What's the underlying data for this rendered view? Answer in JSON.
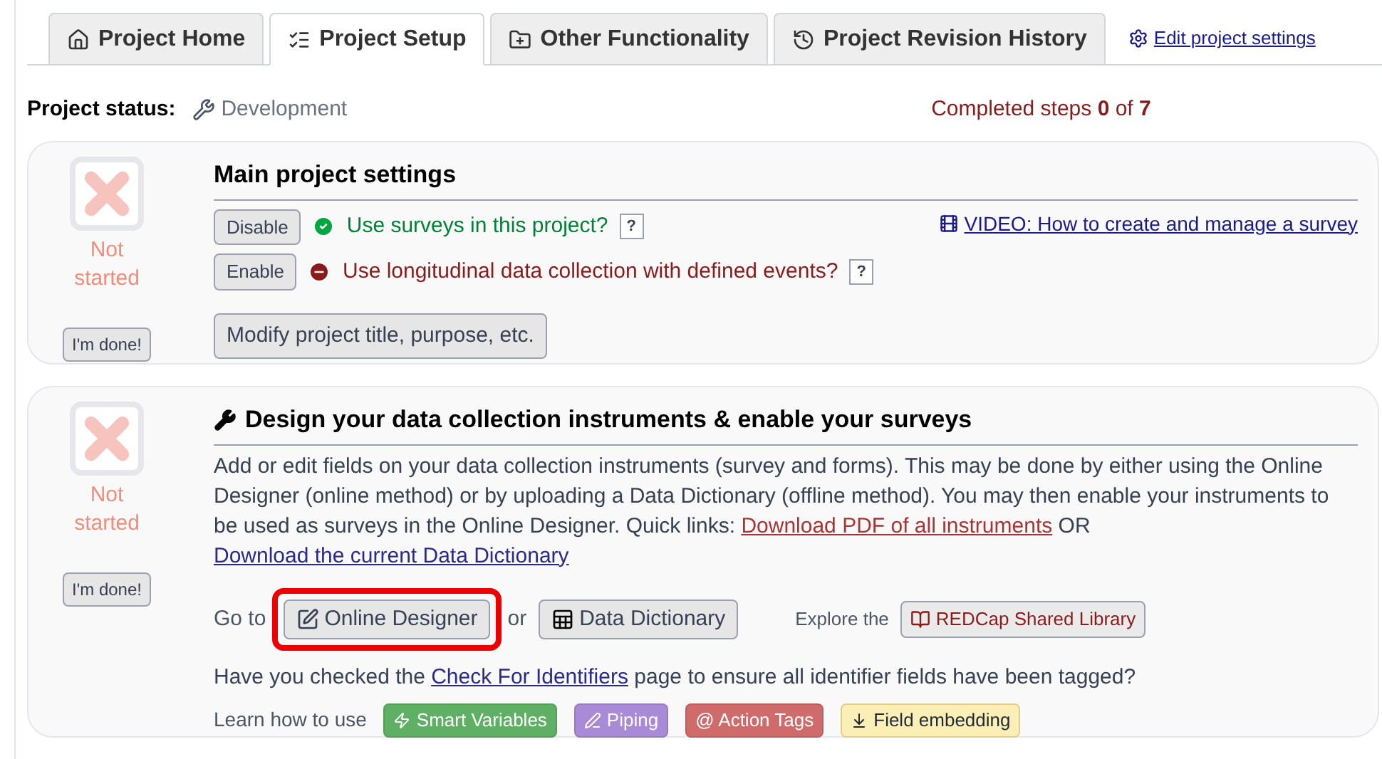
{
  "tabs": [
    {
      "label": "Project Home",
      "kind": "home",
      "selected": false
    },
    {
      "label": "Project Setup",
      "kind": "setup",
      "selected": true
    },
    {
      "label": "Other Functionality",
      "kind": "other",
      "selected": false
    },
    {
      "label": "Project Revision History",
      "kind": "history",
      "selected": false
    }
  ],
  "edit_link": "Edit project settings",
  "status": {
    "label": "Project status:",
    "value": "Development"
  },
  "progress": "Completed steps **0** of **7**",
  "main_settings": {
    "completed": false,
    "status_text": "Not started",
    "done_button": "I'm done!",
    "title": "Main project settings",
    "options": [
      {
        "button": "Disable",
        "enabled": true,
        "label": "Use surveys in this project?",
        "help": "?"
      },
      {
        "button": "Enable",
        "enabled": false,
        "label": "Use longitudinal data collection with defined events?",
        "help": "?"
      }
    ],
    "video_link": "VIDEO: How to create and manage a survey",
    "modify_button": "Modify project title, purpose, etc."
  },
  "design": {
    "completed": false,
    "status_text": "Not started",
    "done_button": "I'm done!",
    "title": "Design your data collection instruments & enable your surveys",
    "description": [
      {
        "kind": "text",
        "text": "Add or edit fields on your data collection instruments (survey and forms). This may be done by either using the Online Designer (online method) or by uploading a Data Dictionary (offline method). You may then enable your instruments to be used as surveys in the Online Designer. Quick links: "
      },
      {
        "kind": "link",
        "text": "Download PDF of all instruments"
      },
      {
        "kind": "text",
        "text": " OR "
      },
      {
        "kind": "link",
        "text": "Download the current Data Dictionary"
      }
    ],
    "go_to": "Go to",
    "designer_button": {
      "label": "Online Designer",
      "highlighted": true
    },
    "or": "or",
    "dictionary_button": "Data Dictionary",
    "explore_label": "Explore the",
    "library_button": "REDCap Shared Library",
    "identifiers": [
      {
        "kind": "text",
        "text": "Have you checked the "
      },
      {
        "kind": "link",
        "text": "Check For Identifiers"
      },
      {
        "kind": "text",
        "text": " page to ensure all identifier fields have been tagged?"
      }
    ],
    "learn_label": "Learn how to use",
    "tags": [
      {
        "kind": "smart",
        "label": "Smart Variables",
        "color": "#5fb064"
      },
      {
        "kind": "piping",
        "label": "Piping",
        "color": "#a88ad6"
      },
      {
        "kind": "action",
        "label": "@ Action Tags",
        "color": "#d06b6b"
      },
      {
        "kind": "embed",
        "label": "Field embedding",
        "color": "#fcefb5"
      }
    ]
  }
}
